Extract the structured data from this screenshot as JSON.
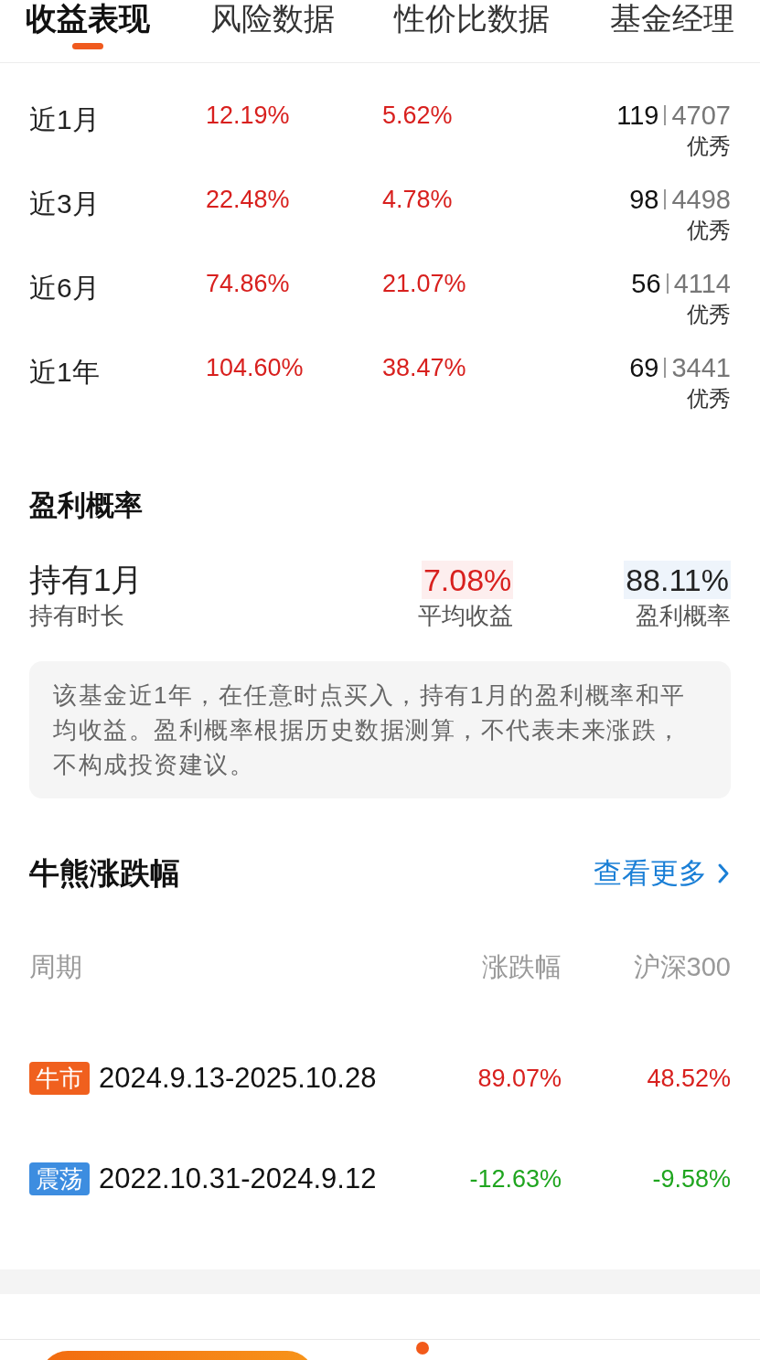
{
  "tabs": [
    {
      "label": "收益表现",
      "selected": true
    },
    {
      "label": "风险数据",
      "selected": false
    },
    {
      "label": "性价比数据",
      "selected": false
    },
    {
      "label": "基金经理",
      "selected": false
    }
  ],
  "returns": [
    {
      "period": "近1月",
      "value_1": "12.19%",
      "value_2": "5.62%",
      "rank": "119",
      "total": "4707",
      "rating": "优秀"
    },
    {
      "period": "近3月",
      "value_1": "22.48%",
      "value_2": "4.78%",
      "rank": "98",
      "total": "4498",
      "rating": "优秀"
    },
    {
      "period": "近6月",
      "value_1": "74.86%",
      "value_2": "21.07%",
      "rank": "56",
      "total": "4114",
      "rating": "优秀"
    },
    {
      "period": "近1年",
      "value_1": "104.60%",
      "value_2": "38.47%",
      "rank": "69",
      "total": "3441",
      "rating": "优秀"
    }
  ],
  "profit": {
    "title": "盈利概率",
    "hold": "持有1月",
    "hold_label": "持有时长",
    "average": "7.08%",
    "average_label": "平均收益",
    "probability": "88.11%",
    "probability_label": "盈利概率",
    "note": "该基金近1年，在任意时点买入，持有1月的盈利概率和平均收益。盈利概率根据历史数据测算，不代表未来涨跌，不构成投资建议。"
  },
  "bull_bear": {
    "title": "牛熊涨跌幅",
    "more_link": "查看更多",
    "columns": [
      "周期",
      "涨跌幅",
      "沪深300"
    ],
    "rows": [
      {
        "kind": "bull",
        "tag": "牛市",
        "period": "2024.9.13-2025.10.28",
        "change": "89.07%",
        "index_change": "48.52%"
      },
      {
        "kind": "range",
        "tag": "震荡",
        "period": "2022.10.31-2024.9.12",
        "change": "-12.63%",
        "index_change": "-9.58%"
      }
    ]
  }
}
